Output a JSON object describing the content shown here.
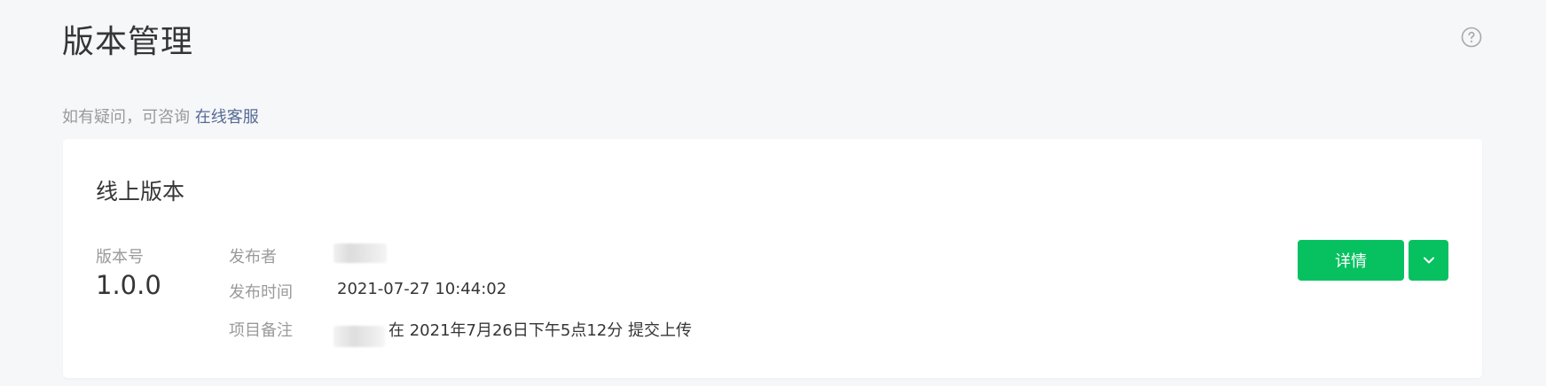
{
  "page": {
    "title": "版本管理",
    "help_icon": "question-circle-icon"
  },
  "hint": {
    "text": "如有疑问，可咨询 ",
    "link": "在线客服"
  },
  "online_version": {
    "title": "线上版本",
    "version_label": "版本号",
    "version_value": "1.0.0",
    "publisher_label": "发布者",
    "publish_time_label": "发布时间",
    "publish_time_value": "2021-07-27 10:44:02",
    "remark_label": "项目备注",
    "remark_value": "在 2021年7月26日下午5点12分 提交上传",
    "detail_button": "详情",
    "dropdown_icon": "chevron-down-icon"
  },
  "colors": {
    "primary": "#07c160",
    "link": "#576b95",
    "muted": "#9a9a9a",
    "text": "#353535",
    "background": "#f6f7f9"
  }
}
